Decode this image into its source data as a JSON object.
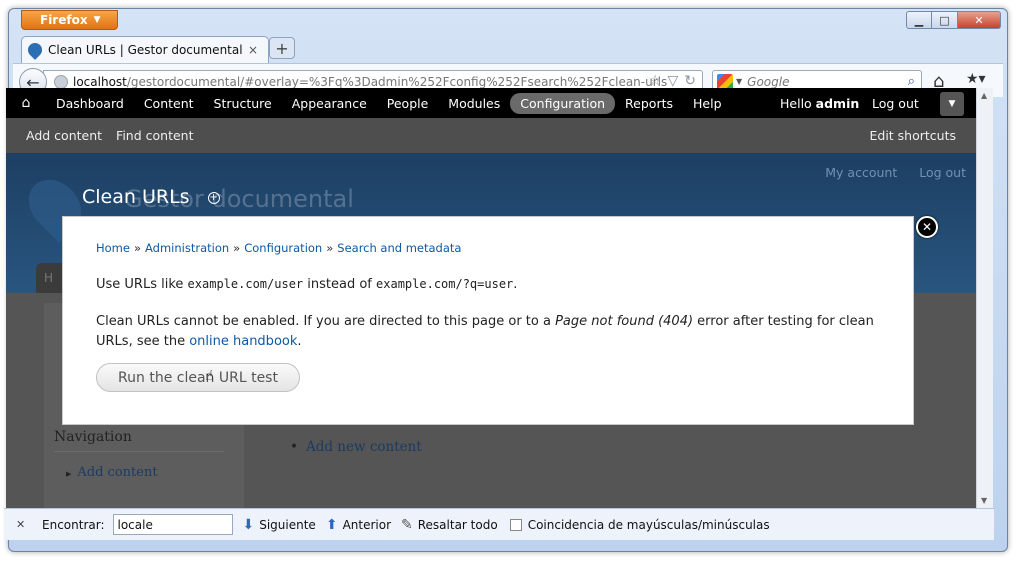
{
  "browser": {
    "menu_button": "Firefox",
    "window_controls": {
      "minimize": "▁",
      "maximize": "□",
      "close": "✕"
    },
    "tab": {
      "title": "Clean URLs | Gestor documental",
      "close": "×"
    },
    "new_tab": "+",
    "url": {
      "host": "localhost",
      "path": "/gestordocumental/#overlay=%3Fq%3Dadmin%252Fconfig%252Fsearch%252Fclean-urls"
    },
    "search": {
      "placeholder": "Google"
    }
  },
  "toolbar": {
    "home_icon": "home-icon",
    "items": [
      "Dashboard",
      "Content",
      "Structure",
      "Appearance",
      "People",
      "Modules",
      "Configuration",
      "Reports",
      "Help"
    ],
    "active_item": "Configuration",
    "hello_prefix": "Hello ",
    "username": "admin",
    "logout": "Log out"
  },
  "shortcuts": {
    "items": [
      "Add content",
      "Find content"
    ],
    "edit": "Edit shortcuts"
  },
  "site": {
    "name": "Gestor documental",
    "secondary_links": [
      "My account",
      "Log out"
    ],
    "tab_letter": "H",
    "navigation_title": "Navigation",
    "navigation_link": "Add content",
    "main_link": "Add new content"
  },
  "overlay": {
    "title": "Clean URLs",
    "add_shortcut": "+",
    "close": "✕",
    "breadcrumb": [
      "Home",
      "Administration",
      "Configuration",
      "Search and metadata"
    ],
    "breadcrumb_separator": "»",
    "p1_a": "Use URLs like ",
    "p1_code1": "example.com/user",
    "p1_b": " instead of ",
    "p1_code2": "example.com/?q=user",
    "p1_c": ".",
    "p2_a": "Clean URLs cannot be enabled. If you are directed to this page or to a ",
    "p2_em": "Page not found (404)",
    "p2_b": " error after testing for clean URLs, see the ",
    "p2_link": "online handbook",
    "p2_c": ".",
    "button": "Run the clean URL test"
  },
  "findbar": {
    "label": "Encontrar:",
    "value": "locale",
    "next": "Siguiente",
    "previous": "Anterior",
    "highlight": "Resaltar todo",
    "match_case": "Coincidencia de mayúsculas/minúsculas",
    "match_case_checked": false
  }
}
